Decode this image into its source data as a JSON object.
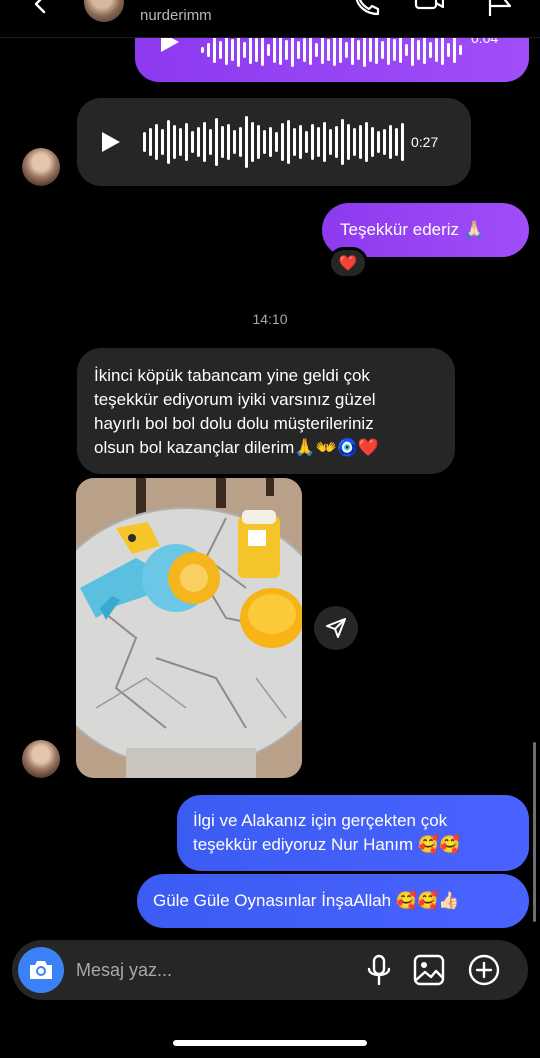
{
  "header": {
    "username": "nurderimm",
    "icons": [
      "back-icon",
      "phone-icon",
      "video-icon",
      "flag-icon"
    ]
  },
  "messages": {
    "voice_top": {
      "duration": "0:04"
    },
    "voice_incoming": {
      "duration": "0:27"
    },
    "thanks": {
      "text": "Teşekkür ederiz 🙏🏻",
      "reaction": "❤️"
    },
    "timestamp": "14:10",
    "customer_text": {
      "line1": "İkinci köpük tabancam yine geldi çok",
      "line2": "teşekkür ediyorum iyiki varsınız güzel",
      "line3": "hayırlı bol bol dolu dolu müşterileriniz",
      "line4": "olsun bol kazançlar dilerim🙏👐🧿❤️"
    },
    "reply1": {
      "line1": "İlgi ve Alakanız için gerçekten çok",
      "line2": "teşekkür ediyoruz Nur Hanım 🥰🥰"
    },
    "reply2": {
      "text": "Güle Güle Oynasınlar İnşaAllah 🥰🥰👍🏻"
    }
  },
  "composer": {
    "placeholder": "Mesaj yaz...",
    "icons": [
      "camera-icon",
      "microphone-icon",
      "gallery-icon",
      "plus-icon"
    ]
  },
  "colors": {
    "outgoing_purple": "#9b45f6",
    "outgoing_blue": "#4a63ff",
    "incoming_gray": "#262626",
    "camera_blue": "#3b82f6"
  }
}
